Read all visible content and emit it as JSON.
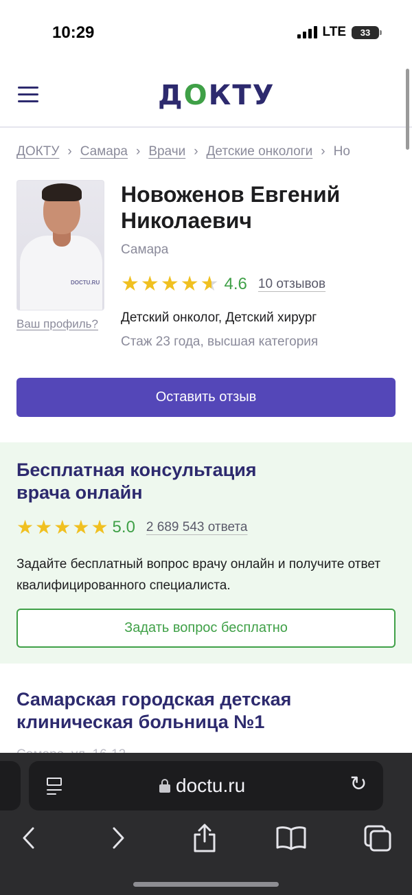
{
  "status_bar": {
    "time": "10:29",
    "network": "LTE",
    "battery": "33"
  },
  "header": {
    "logo": "ДОКТУ"
  },
  "breadcrumb": {
    "items": [
      "ДОКТУ",
      "Самара",
      "Врачи",
      "Детские онкологи",
      "Но"
    ],
    "separator": "›"
  },
  "doctor": {
    "name": "Новоженов Евгений Николаевич",
    "city": "Самара",
    "rating": "4.6",
    "rating_value": 4.6,
    "reviews_link": "10 отзывов",
    "specialties": "Детский онколог, Детский хирург",
    "experience": "Стаж 23 года, высшая категория",
    "profile_link": "Ваш профиль?",
    "photo_watermark": "DOCTU.RU"
  },
  "review_button": "Оставить отзыв",
  "consultation": {
    "title": "Бесплатная консультация врача онлайн",
    "rating": "5.0",
    "rating_value": 5.0,
    "answers_link": "2 689 543 ответа",
    "description": "Задайте бесплатный вопрос врачу онлайн и получите ответ квалифицированного специалиста.",
    "button": "Задать вопрос бесплатно"
  },
  "hospital": {
    "title": "Самарская городская детская клиническая больница №1",
    "faded_text": "Самара, ул. 16-12"
  },
  "browser": {
    "url": "doctu.ru",
    "icons": [
      "reader-icon",
      "lock-icon",
      "reload-icon",
      "back-icon",
      "forward-icon",
      "share-icon",
      "bookmarks-icon",
      "tabs-icon"
    ]
  },
  "colors": {
    "brand_purple": "#2d2a6e",
    "button_purple": "#5447b8",
    "accent_green": "#3fa047",
    "star_yellow": "#f0c020",
    "consult_bg": "#eef8ee"
  }
}
